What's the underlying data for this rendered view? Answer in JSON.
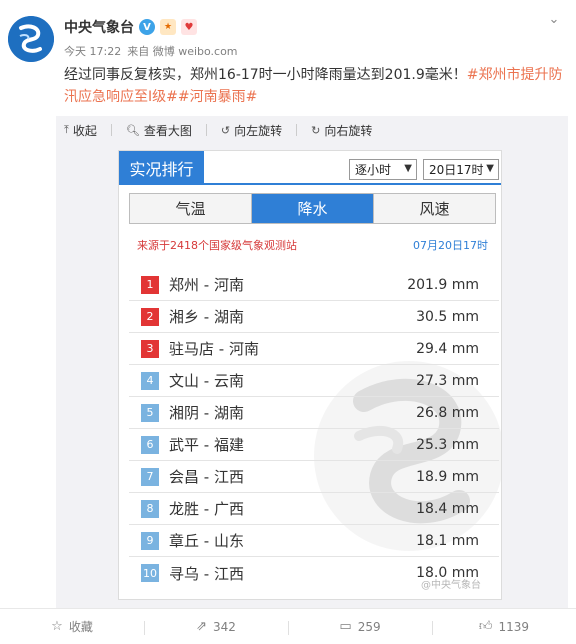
{
  "account": {
    "name": "中央气象台",
    "verify_icon": "verified-icon",
    "time": "今天 17:22",
    "source": "来自 微博 weibo.com"
  },
  "post": {
    "text": "经过同事反复核实，郑州16-17时一小时降雨量达到201.9毫米！",
    "hashtag1": "#郑州市提升防汛应急响应至I级#",
    "hashtag2": "#河南暴雨#"
  },
  "toolbar": {
    "collapse": "收起",
    "view_large": "查看大图",
    "rotate_left": "向左旋转",
    "rotate_right": "向右旋转"
  },
  "card": {
    "title": "实况排行",
    "interval_select": "逐小时",
    "time_select": "20日17时",
    "tabs": [
      "气温",
      "降水",
      "风速"
    ],
    "active_tab": "降水",
    "source_note": "来源于2418个国家级气象观测站",
    "timestamp": "07月20日17时",
    "rows": [
      {
        "rank": "1",
        "station": "郑州 - 河南",
        "value": "201.9 mm"
      },
      {
        "rank": "2",
        "station": "湘乡 - 湖南",
        "value": "30.5 mm"
      },
      {
        "rank": "3",
        "station": "驻马店 - 河南",
        "value": "29.4 mm"
      },
      {
        "rank": "4",
        "station": "文山 - 云南",
        "value": "27.3 mm"
      },
      {
        "rank": "5",
        "station": "湘阴 - 湖南",
        "value": "26.8 mm"
      },
      {
        "rank": "6",
        "station": "武平 - 福建",
        "value": "25.3 mm"
      },
      {
        "rank": "7",
        "station": "会昌 - 江西",
        "value": "18.9 mm"
      },
      {
        "rank": "8",
        "station": "龙胜 - 广西",
        "value": "18.4 mm"
      },
      {
        "rank": "9",
        "station": "章丘 - 山东",
        "value": "18.1 mm"
      },
      {
        "rank": "10",
        "station": "寻乌 - 江西",
        "value": "18.0 mm"
      }
    ],
    "watermark_text": "@中央气象台"
  },
  "footer": {
    "favorite": "收藏",
    "repost": "342",
    "comment": "259",
    "like": "1139"
  },
  "colors": {
    "accent_blue": "#2f7fd6",
    "rank_hot": "#e23535",
    "rank_cool": "#7ab3e0",
    "link": "#eb7350"
  }
}
